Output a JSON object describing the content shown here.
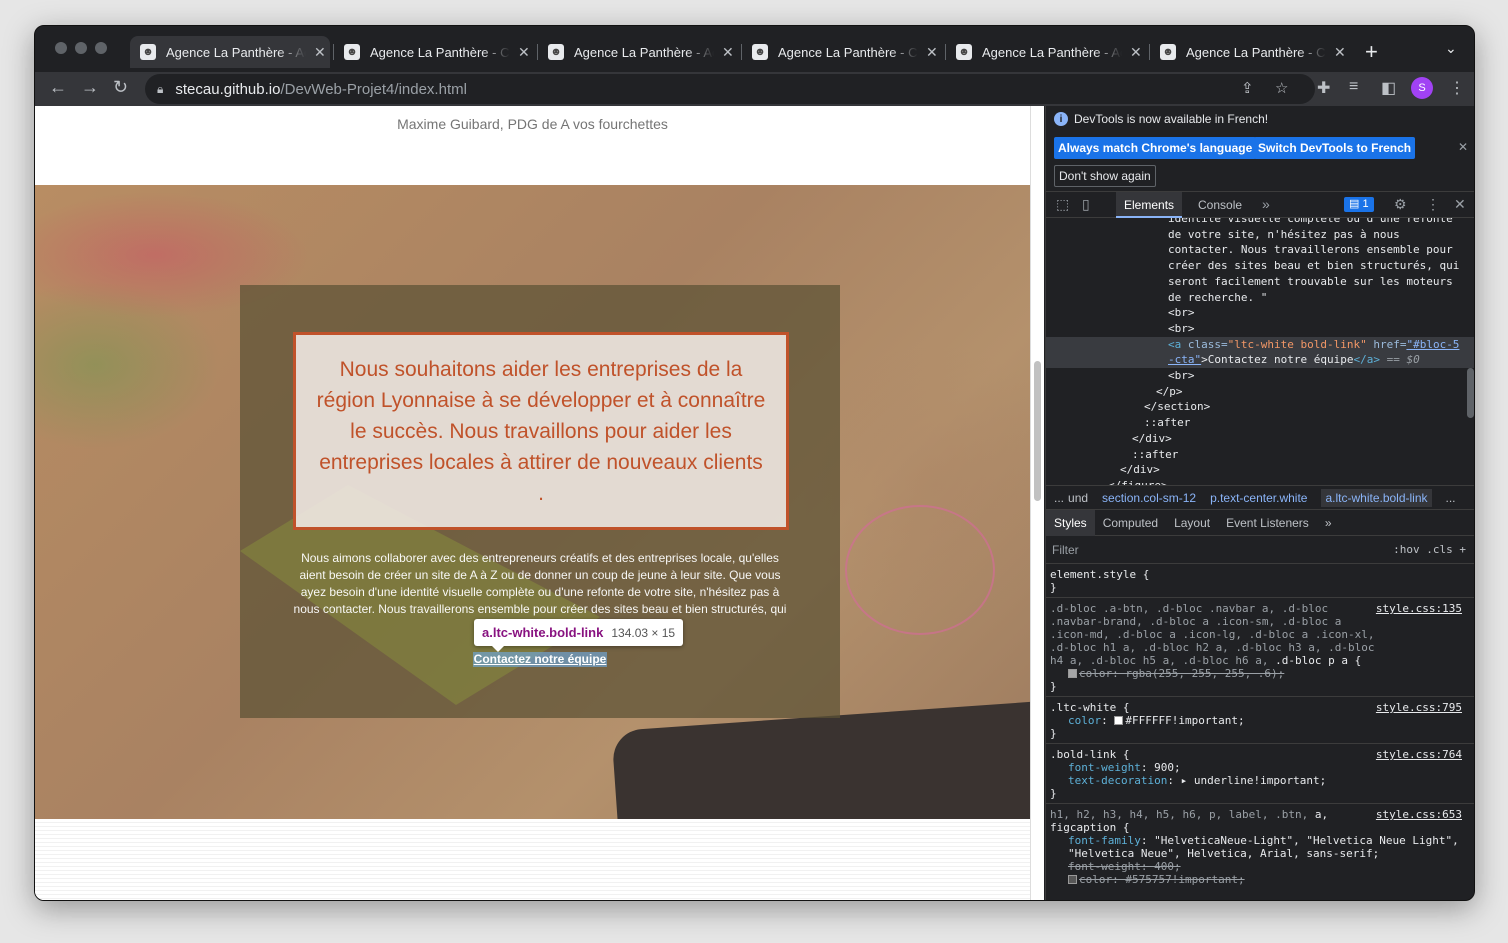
{
  "tabs": [
    {
      "title": "Agence La Panthère - Ac"
    },
    {
      "title": "Agence La Panthère - Co"
    },
    {
      "title": "Agence La Panthère - Ac"
    },
    {
      "title": "Agence La Panthère - Co"
    },
    {
      "title": "Agence La Panthère - Ac"
    },
    {
      "title": "Agence La Panthère - Co"
    }
  ],
  "address": {
    "host": "stecau.github.io",
    "path": "/DevWeb-Projet4/index.html"
  },
  "profile_initial": "S",
  "page": {
    "caption": "Maxime Guibard, PDG de A vos fourchettes",
    "quote": "Nous souhaitons aider les entreprises de la région Lyonnaise à se développer et à connaître le succès. Nous travaillons pour aider les entreprises locales à attirer de nouveaux clients .",
    "body": "Nous aimons collaborer avec des entrepreneurs créatifs et des entreprises locale, qu'elles aient besoin de créer un site de A à Z ou de donner un coup de jeune à leur site. Que vous ayez besoin d'une identité visuelle complète ou d'une refonte de votre site, n'hésitez pas à nous contacter. Nous travaillerons ensemble pour créer des sites beau et bien structurés, qui seront facilement tr",
    "cta": "Contactez notre équipe"
  },
  "tooltip": {
    "selector": "a.ltc-white.bold-link",
    "size": "134.03 × 15"
  },
  "devtools": {
    "info_message": "DevTools is now available in French!",
    "btn_match": "Always match Chrome's language",
    "btn_switch": "Switch DevTools to French",
    "btn_dont": "Don't show again",
    "tab_elements": "Elements",
    "tab_console": "Console",
    "issues_count": "1",
    "elements_lines": [
      "identite visuelle complete ou d'une refonte",
      "de votre site, n'hésitez pas à nous",
      "contacter. Nous travaillerons ensemble pour",
      "créer des sites beau et bien structurés, qui",
      "seront facilement trouvable sur les moteurs",
      "de recherche. \""
    ],
    "br": "<br>",
    "a_open": "<a ",
    "a_class_attr": "class=",
    "a_class_val": "\"ltc-white bold-link\"",
    "a_href_attr": " href=",
    "a_href_val": "\"#bloc-5",
    "a_href_val2": "-cta\"",
    "a_text": ">Contactez notre équipe",
    "a_close": "</a>",
    "eq0": " == $0",
    "p_close": "</p>",
    "section_close": "</section>",
    "after": "::after",
    "div_close": "</div>",
    "figure_close": "</figure>",
    "crumbs": [
      "...",
      "und",
      "section.col-sm-12",
      "p.text-center.white",
      "a.ltc-white.bold-link",
      "..."
    ],
    "subtabs": [
      "Styles",
      "Computed",
      "Layout",
      "Event Listeners"
    ],
    "filter_placeholder": "Filter",
    "filter_right": ":hov  .cls  +",
    "rules": {
      "r0_sel": "element.style {",
      "r1_sel": ".d-bloc .a-btn, .d-bloc .navbar a, .d-bloc .navbar-brand, .d-bloc a .icon-sm, .d-bloc a .icon-md, .d-bloc a .icon-lg, .d-bloc a .icon-xl, .d-bloc h1 a, .d-bloc h2 a, .d-bloc h3 a, .d-bloc h4 a, .d-bloc h5 a, .d-bloc h6 a,",
      "r1_sel_b": ".d-bloc p a {",
      "r1_src": "style.css:135",
      "r1_decl": "color: rgba(255, 255, 255, .6);",
      "r2_sel": ".ltc-white {",
      "r2_src": "style.css:795",
      "r2_prop": "color",
      "r2_val": "#FFFFFF!important;",
      "r3_sel": ".bold-link {",
      "r3_src": "style.css:764",
      "r3_p1": "font-weight",
      "r3_v1": "900;",
      "r3_p2": "text-decoration",
      "r3_v2": "underline!important;",
      "r4_sel": "h1, h2, h3, h4, h5, h6, p, label, .btn,",
      "r4_sel_b": "a,",
      "r4_sel2": "figcaption {",
      "r4_src": "style.css:653",
      "r4_p1": "font-family",
      "r4_v1": "\"HelveticaNeue-Light\", \"Helvetica Neue Light\", \"Helvetica Neue\", Helvetica, Arial, sans-serif;",
      "r4_d2": "font-weight: 400;",
      "r4_d3": "color: #575757!important;",
      "close": "}"
    }
  }
}
